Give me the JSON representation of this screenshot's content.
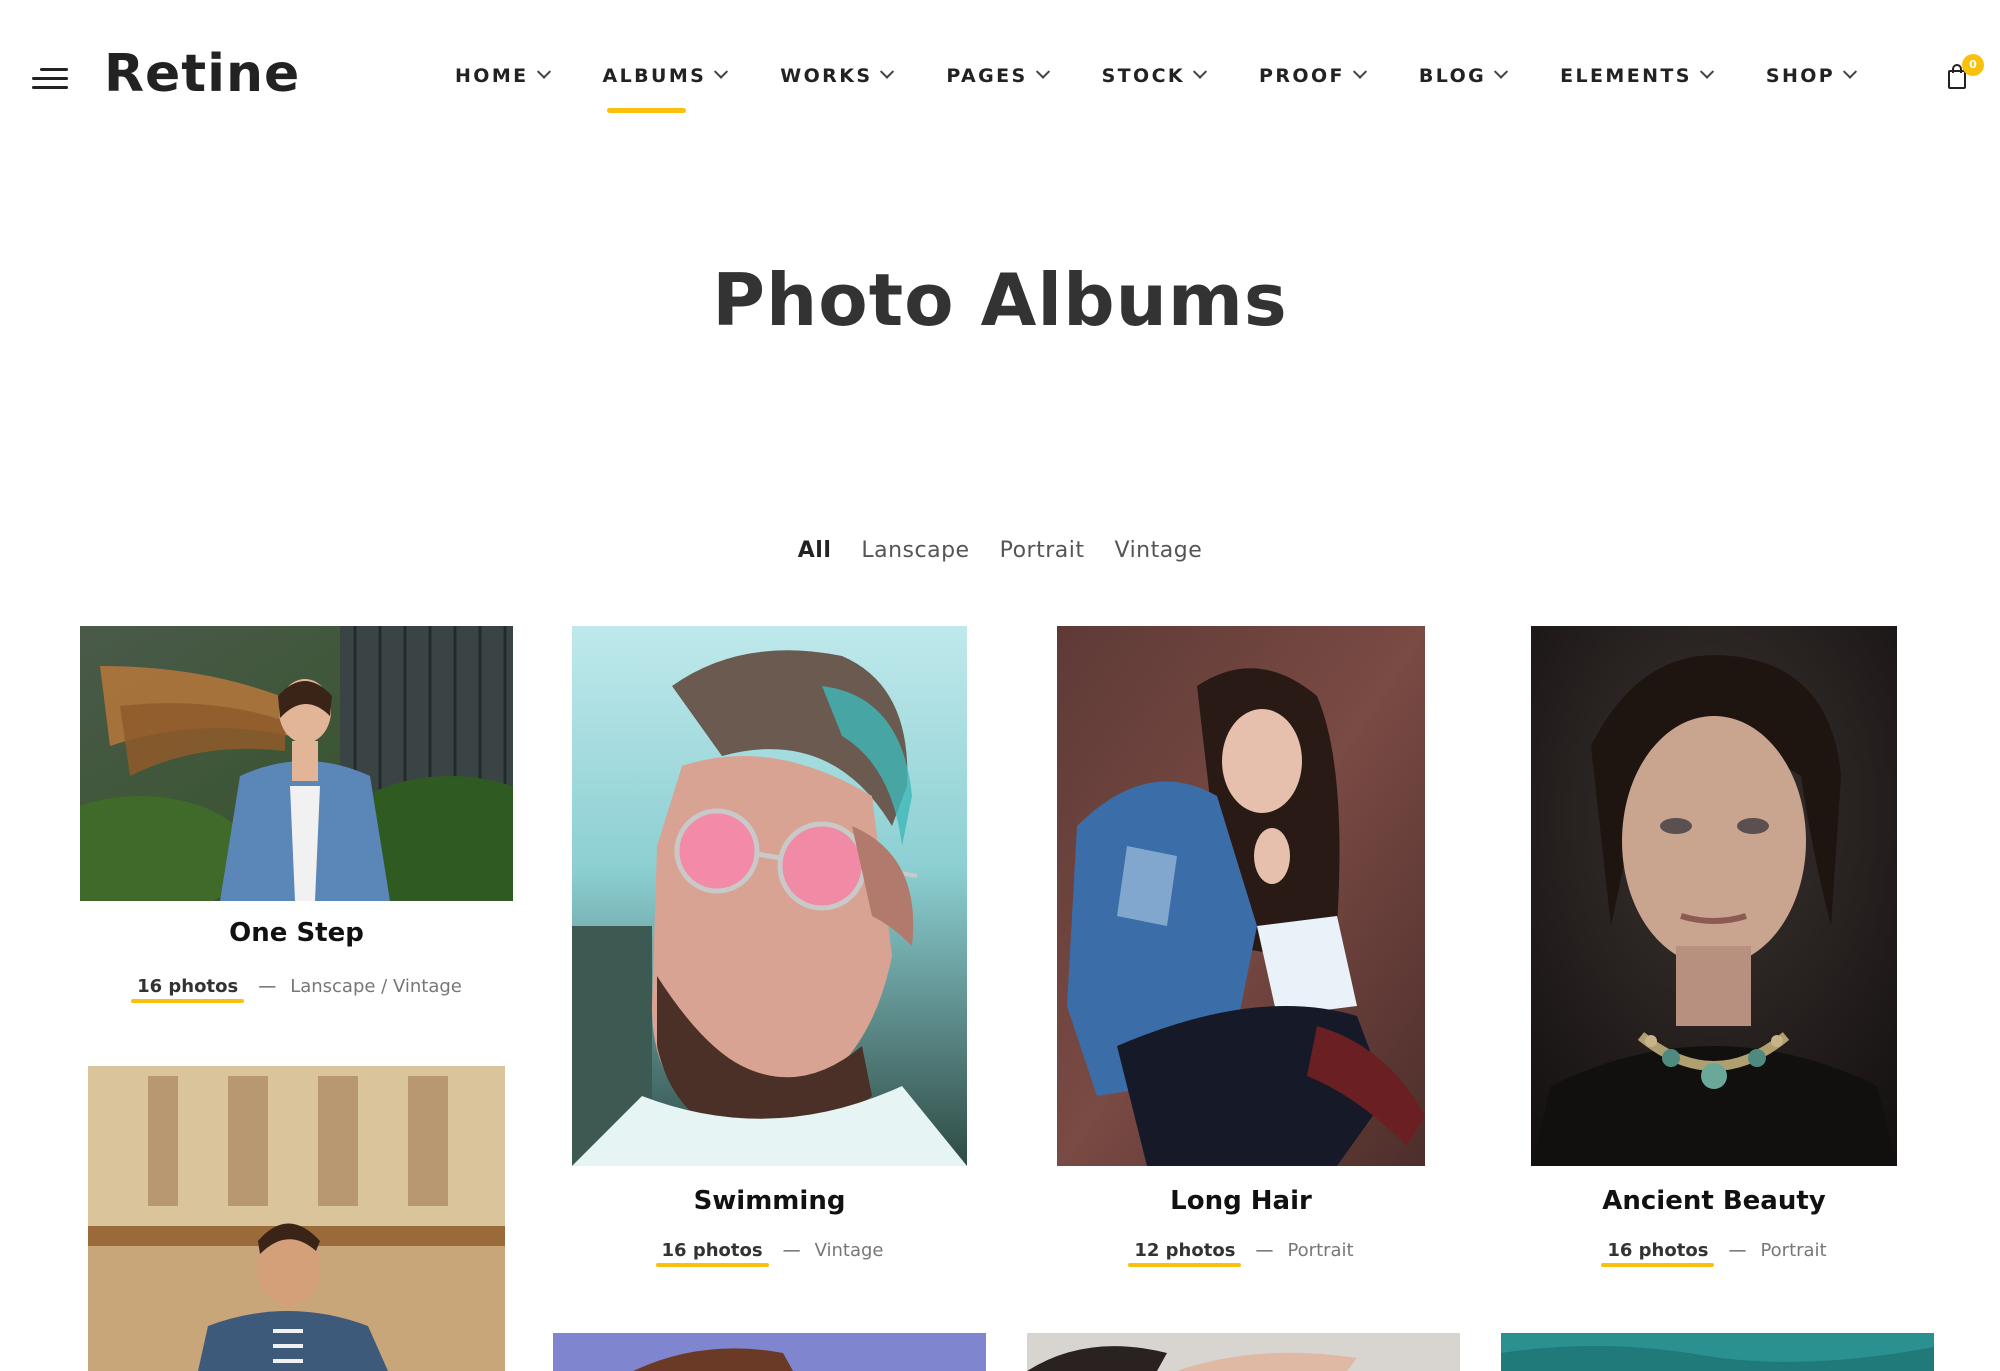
{
  "brand": {
    "logo": "Retine"
  },
  "nav": {
    "items": [
      {
        "label": "HOME"
      },
      {
        "label": "ALBUMS"
      },
      {
        "label": "WORKS"
      },
      {
        "label": "PAGES"
      },
      {
        "label": "STOCK"
      },
      {
        "label": "PROOF"
      },
      {
        "label": "BLOG"
      },
      {
        "label": "ELEMENTS"
      },
      {
        "label": "SHOP"
      }
    ],
    "active": "ALBUMS"
  },
  "cart": {
    "count": "0"
  },
  "page": {
    "title": "Photo Albums"
  },
  "filters": [
    "All",
    "Lanscape",
    "Portrait",
    "Vintage"
  ],
  "albums": [
    {
      "title": "One Step",
      "count": "16 photos",
      "tags": "Lanscape / Vintage"
    },
    {
      "title": "Swimming",
      "count": "16 photos",
      "tags": "Vintage"
    },
    {
      "title": "Long Hair",
      "count": "12 photos",
      "tags": "Portrait"
    },
    {
      "title": "Ancient Beauty",
      "count": "16 photos",
      "tags": "Portrait"
    }
  ],
  "separator": "—",
  "colors": {
    "accent": "#f9c10e",
    "text": "#222222",
    "muted": "#777777"
  }
}
